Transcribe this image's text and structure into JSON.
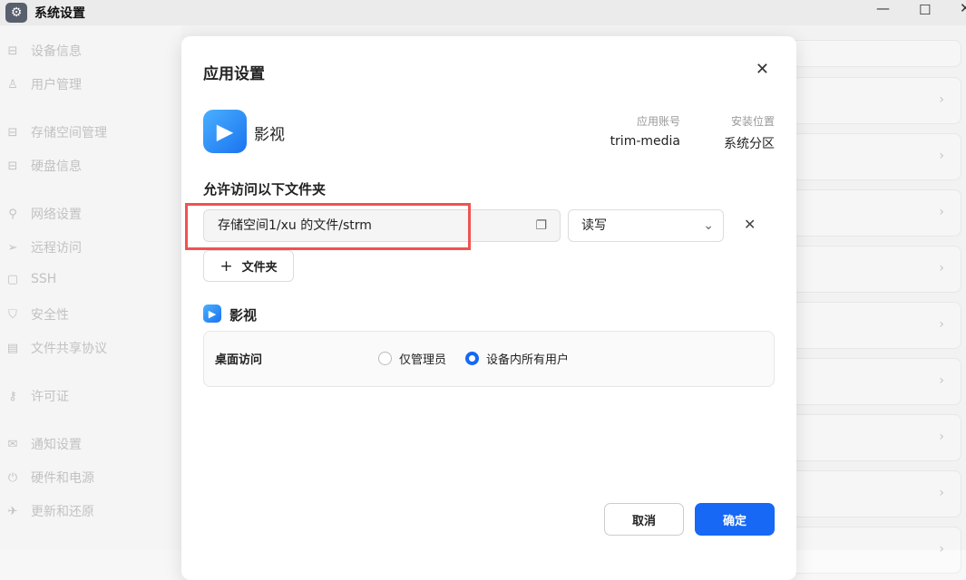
{
  "window": {
    "title": "系统设置",
    "icon": "gear-icon",
    "controls": [
      "—",
      "☐",
      "✕"
    ]
  },
  "sidebar": {
    "items": [
      {
        "label": "设备信息",
        "icon": "drive-icon",
        "glyph": "⊟"
      },
      {
        "label": "用户管理",
        "icon": "users-icon",
        "glyph": "♙"
      },
      {
        "label": "存储空间管理",
        "icon": "storage-icon",
        "glyph": "⊟"
      },
      {
        "label": "硬盘信息",
        "icon": "disk-icon",
        "glyph": "⊟"
      },
      {
        "label": "网络设置",
        "icon": "network-icon",
        "glyph": "⚲"
      },
      {
        "label": "远程访问",
        "icon": "send-icon",
        "glyph": "➢"
      },
      {
        "label": "SSH",
        "icon": "terminal-icon",
        "glyph": "▢"
      },
      {
        "label": "安全性",
        "icon": "shield-icon",
        "glyph": "⛉"
      },
      {
        "label": "文件共享协议",
        "icon": "file-icon",
        "glyph": "▤"
      },
      {
        "label": "许可证",
        "icon": "key-icon",
        "glyph": "⚷"
      },
      {
        "label": "通知设置",
        "icon": "mail-icon",
        "glyph": "✉"
      },
      {
        "label": "硬件和电源",
        "icon": "power-icon",
        "glyph": "⏻"
      },
      {
        "label": "更新和还原",
        "icon": "rocket-icon",
        "glyph": "✈"
      }
    ]
  },
  "dialog": {
    "title": "应用设置",
    "app_name": "影视",
    "account_label": "应用账号",
    "account_value": "trim-media",
    "location_label": "安装位置",
    "location_value": "系统分区",
    "folders_heading": "允许访问以下文件夹",
    "folder_path": "存储空间1/xu 的文件/strm",
    "permission": "读写",
    "add_folder_label": "文件夹",
    "section_app_name": "影视",
    "desktop_access_label": "桌面访问",
    "radio_options": [
      {
        "label": "仅管理员",
        "selected": false
      },
      {
        "label": "设备内所有用户",
        "selected": true
      }
    ],
    "cancel_label": "取消",
    "ok_label": "确定"
  },
  "colors": {
    "accent": "#1668f5",
    "highlight": "#ef5350"
  }
}
